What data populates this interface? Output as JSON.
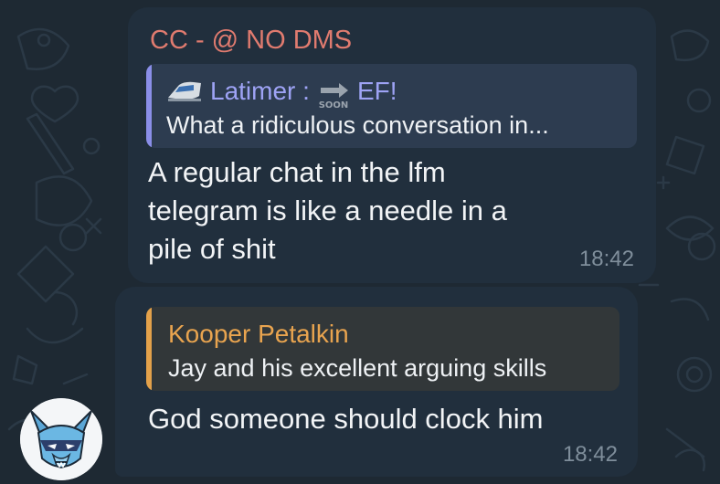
{
  "messages": [
    {
      "sender": "CC - @ NO DMS",
      "reply_to": {
        "name_prefix": "Latimer : ",
        "name_suffix": "EF!",
        "prefix_icon": "train-icon",
        "inline_icon": "soon-arrow-icon",
        "text": "What a ridiculous conversation in..."
      },
      "text": "A regular chat in the lfm telegram is like a needle in a pile of shit",
      "time": "18:42"
    },
    {
      "reply_to": {
        "name": "Kooper Petalkin",
        "text": "Jay and his excellent arguing skills"
      },
      "text": "God someone should clock him",
      "time": "18:42",
      "avatar": "dragon-avatar"
    }
  ],
  "colors": {
    "background": "#1e2933",
    "bubble": "#212f3d",
    "sender": "#e07b6f",
    "reply1_accent": "#8a8ee8",
    "reply2_accent": "#e3a14a",
    "time": "#7f8e9b"
  }
}
